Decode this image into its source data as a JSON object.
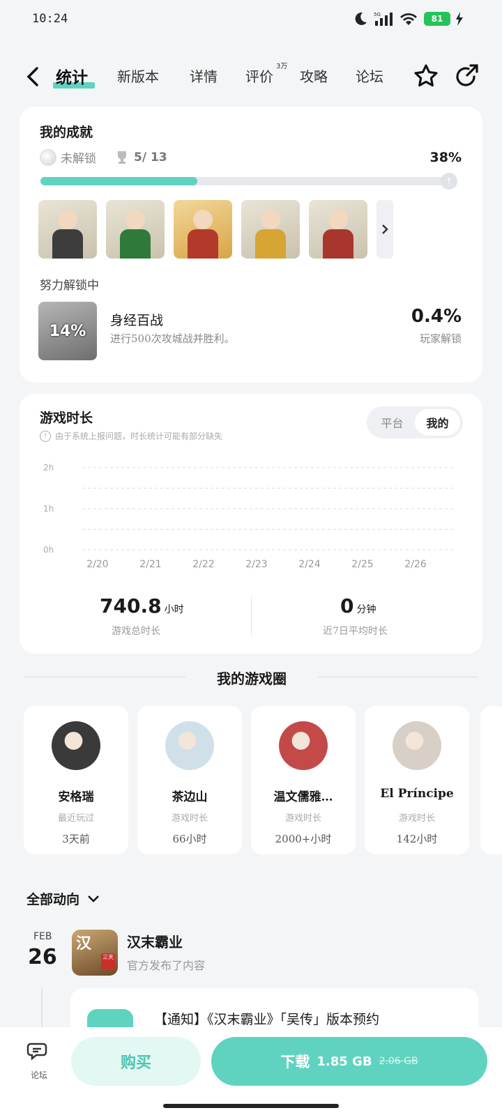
{
  "status_bar": {
    "time": "10:24",
    "network": "5G",
    "battery": "81"
  },
  "nav": {
    "tabs": [
      {
        "label": "统计",
        "active": true
      },
      {
        "label": "新版本"
      },
      {
        "label": "详情"
      },
      {
        "label": "评价",
        "badge": "3万"
      },
      {
        "label": "攻略"
      },
      {
        "label": "论坛"
      }
    ]
  },
  "achievements": {
    "title": "我的成就",
    "locked_label": "未解锁",
    "count": "5/ 13",
    "percent": "38%",
    "progress": 0.38,
    "in_progress_label": "努力解锁中",
    "in_progress": {
      "badge": "14%",
      "name": "身经百战",
      "desc": "进行500次攻城战并胜利。",
      "rate": "0.4%",
      "rate_label": "玩家解锁"
    }
  },
  "playtime": {
    "title": "游戏时长",
    "note": "由于系统上报问题，时长统计可能有部分缺失",
    "toggle": [
      "平台",
      "我的"
    ],
    "toggle_active": "我的",
    "total_value": "740.8",
    "total_unit": "小时",
    "total_label": "游戏总时长",
    "avg_value": "0",
    "avg_unit": "分钟",
    "avg_label": "近7日平均时长"
  },
  "chart_data": {
    "type": "bar",
    "categories": [
      "2/20",
      "2/21",
      "2/22",
      "2/23",
      "2/24",
      "2/25",
      "2/26"
    ],
    "values": [
      0,
      0,
      0,
      0,
      0,
      0,
      0
    ],
    "y_ticks": [
      "2h",
      "1h",
      "0h"
    ],
    "ylim": [
      0,
      2
    ],
    "grid": true
  },
  "game_circle": {
    "title": "我的游戏圈",
    "friends": [
      {
        "name": "安格瑞",
        "sub": "最近玩过",
        "value": "3天前",
        "color": "#3a3a3a"
      },
      {
        "name": "茶边山",
        "sub": "游戏时长",
        "value": "66小时",
        "color": "#cfe0e8"
      },
      {
        "name": "温文儒雅…",
        "sub": "游戏时长",
        "value": "2000+小时",
        "color": "#c44a4a"
      },
      {
        "name": "El Príncipe",
        "sub": "游戏时长",
        "value": "142小时",
        "color": "#d8cfc6"
      }
    ]
  },
  "feed": {
    "filter_label": "全部动向",
    "month": "FEB",
    "day": "26",
    "icon_char": "汉",
    "icon_seal": "三天",
    "game": "汉末霸业",
    "action": "官方发布了内容",
    "post_title": "【通知】《汉末霸业》「吴传」版本预约"
  },
  "bottom_bar": {
    "forum_label": "论坛",
    "buy_label": "购买",
    "download_label": "下载",
    "download_size": "1.85 GB",
    "download_old_size": "2.06 GB"
  },
  "colors": {
    "accent": "#5fd3c0",
    "background": "#f4f5f7"
  }
}
